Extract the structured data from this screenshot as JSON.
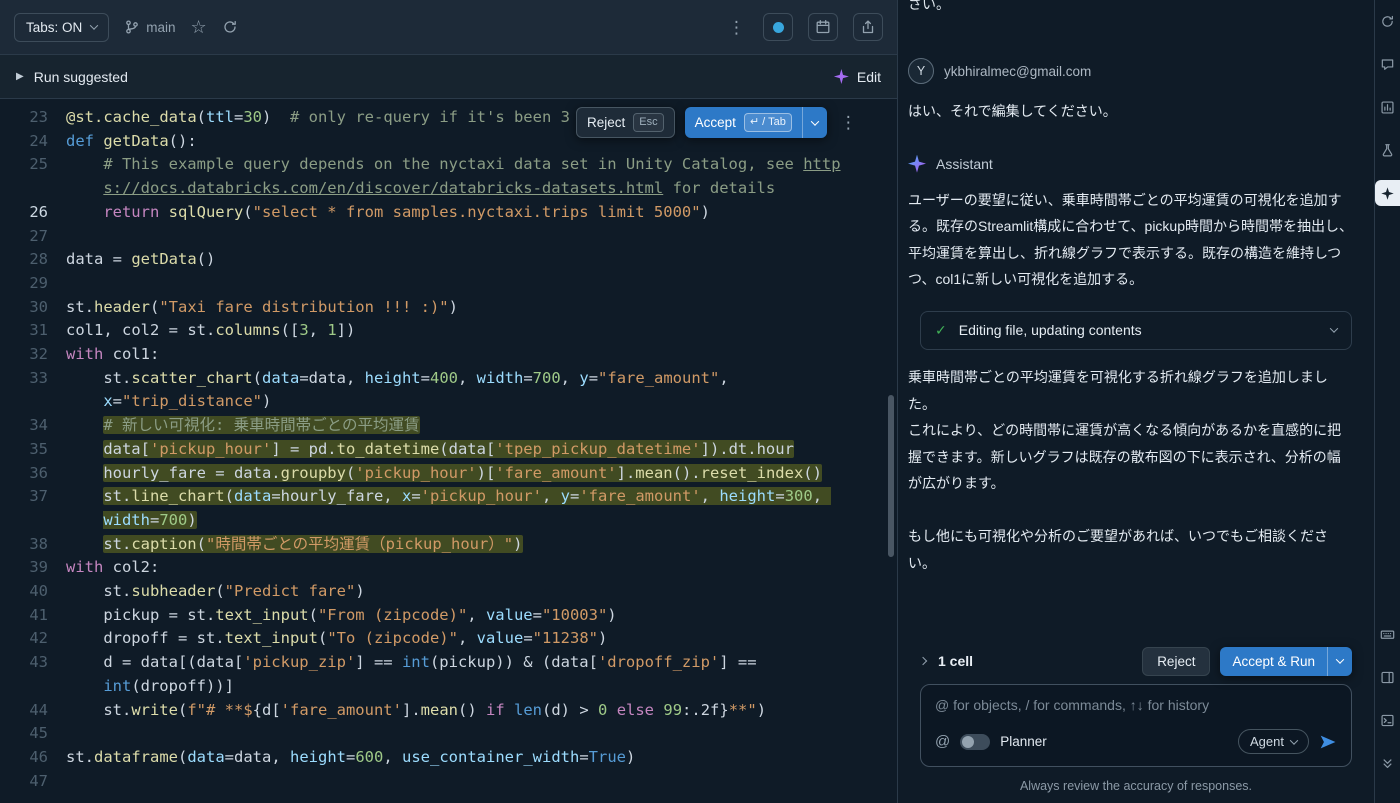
{
  "accent_color": "#2d79c7",
  "toolbar": {
    "tabs_button": "Tabs: ON",
    "branch_name": "main"
  },
  "run_bar": {
    "run_label": "Run suggested",
    "edit_label": "Edit"
  },
  "diff_popup": {
    "reject_label": "Reject",
    "reject_key": "Esc",
    "accept_label": "Accept",
    "accept_key": "↵ / Tab"
  },
  "editor": {
    "active_line": 26,
    "highlight_color": "#414b22",
    "lines": [
      {
        "n": 23,
        "i": 0,
        "h": false,
        "t": [
          [
            "d",
            "@st.cache_data"
          ],
          [
            "p",
            "("
          ],
          [
            "a",
            "ttl"
          ],
          [
            "p",
            "="
          ],
          [
            "n",
            "30"
          ],
          [
            "p",
            ")  "
          ],
          [
            "c",
            "# only re-query if it's been 3"
          ]
        ]
      },
      {
        "n": 24,
        "i": 0,
        "h": false,
        "t": [
          [
            "kb",
            "def "
          ],
          [
            "f",
            "getData"
          ],
          [
            "p",
            "():"
          ]
        ]
      },
      {
        "n": 25,
        "i": 4,
        "h": false,
        "t": [
          [
            "c",
            "# This example query depends on the nyctaxi data set in Unity Catalog, see "
          ],
          [
            "u",
            "https://docs.databricks.com/en/discover/databricks-datasets.html"
          ],
          [
            "c",
            " for details"
          ]
        ]
      },
      {
        "n": 26,
        "i": 4,
        "h": false,
        "t": [
          [
            "k",
            "return "
          ],
          [
            "f",
            "sqlQuery"
          ],
          [
            "p",
            "("
          ],
          [
            "s",
            "\"select * from samples.nyctaxi.trips limit 5000\""
          ],
          [
            "p",
            ")"
          ]
        ]
      },
      {
        "n": 27,
        "i": 0,
        "h": false,
        "t": []
      },
      {
        "n": 28,
        "i": 0,
        "h": false,
        "t": [
          [
            "p",
            "data = "
          ],
          [
            "f",
            "getData"
          ],
          [
            "p",
            "()"
          ]
        ]
      },
      {
        "n": 29,
        "i": 0,
        "h": false,
        "t": []
      },
      {
        "n": 30,
        "i": 0,
        "h": false,
        "t": [
          [
            "p",
            "st."
          ],
          [
            "f",
            "header"
          ],
          [
            "p",
            "("
          ],
          [
            "s",
            "\"Taxi fare distribution !!! :)\""
          ],
          [
            "p",
            ")"
          ]
        ]
      },
      {
        "n": 31,
        "i": 0,
        "h": false,
        "t": [
          [
            "p",
            "col1, col2 = st."
          ],
          [
            "f",
            "columns"
          ],
          [
            "p",
            "(["
          ],
          [
            "n",
            "3"
          ],
          [
            "p",
            ", "
          ],
          [
            "n",
            "1"
          ],
          [
            "p",
            "])"
          ]
        ]
      },
      {
        "n": 32,
        "i": 0,
        "h": false,
        "t": [
          [
            "k",
            "with"
          ],
          [
            "p",
            " col1:"
          ]
        ]
      },
      {
        "n": 33,
        "i": 4,
        "h": false,
        "t": [
          [
            "p",
            "st."
          ],
          [
            "f",
            "scatter_chart"
          ],
          [
            "p",
            "("
          ],
          [
            "a",
            "data"
          ],
          [
            "p",
            "=data, "
          ],
          [
            "a",
            "height"
          ],
          [
            "p",
            "="
          ],
          [
            "n",
            "400"
          ],
          [
            "p",
            ", "
          ],
          [
            "a",
            "width"
          ],
          [
            "p",
            "="
          ],
          [
            "n",
            "700"
          ],
          [
            "p",
            ", "
          ],
          [
            "a",
            "y"
          ],
          [
            "p",
            "="
          ],
          [
            "s",
            "\"fare_amount\""
          ],
          [
            "p",
            ", "
          ],
          [
            "a",
            "x"
          ],
          [
            "p",
            "="
          ],
          [
            "s",
            "\"trip_distance\""
          ],
          [
            "p",
            ")"
          ]
        ]
      },
      {
        "n": 34,
        "i": 4,
        "h": true,
        "t": [
          [
            "c",
            "# 新しい可視化: 乗車時間帯ごとの平均運賃"
          ]
        ]
      },
      {
        "n": 35,
        "i": 4,
        "h": true,
        "t": [
          [
            "p",
            "data["
          ],
          [
            "s",
            "'pickup_hour'"
          ],
          [
            "p",
            "] = pd."
          ],
          [
            "f",
            "to_datetime"
          ],
          [
            "p",
            "(data["
          ],
          [
            "s",
            "'tpep_pickup_datetime'"
          ],
          [
            "p",
            "]).dt.hour"
          ]
        ]
      },
      {
        "n": 36,
        "i": 4,
        "h": true,
        "t": [
          [
            "p",
            "hourly_fare = data."
          ],
          [
            "f",
            "groupby"
          ],
          [
            "p",
            "("
          ],
          [
            "s",
            "'pickup_hour'"
          ],
          [
            "p",
            ")["
          ],
          [
            "s",
            "'fare_amount'"
          ],
          [
            "p",
            "]."
          ],
          [
            "f",
            "mean"
          ],
          [
            "p",
            "()."
          ],
          [
            "f",
            "reset_index"
          ],
          [
            "p",
            "()"
          ]
        ]
      },
      {
        "n": 37,
        "i": 4,
        "h": true,
        "t": [
          [
            "p",
            "st."
          ],
          [
            "f",
            "line_chart"
          ],
          [
            "p",
            "("
          ],
          [
            "a",
            "data"
          ],
          [
            "p",
            "=hourly_fare, "
          ],
          [
            "a",
            "x"
          ],
          [
            "p",
            "="
          ],
          [
            "s",
            "'pickup_hour'"
          ],
          [
            "p",
            ", "
          ],
          [
            "a",
            "y"
          ],
          [
            "p",
            "="
          ],
          [
            "s",
            "'fare_amount'"
          ],
          [
            "p",
            ", "
          ],
          [
            "a",
            "height"
          ],
          [
            "p",
            "="
          ],
          [
            "n",
            "300"
          ],
          [
            "p",
            ", "
          ],
          [
            "a",
            "width"
          ],
          [
            "p",
            "="
          ],
          [
            "n",
            "700"
          ],
          [
            "p",
            ")"
          ]
        ]
      },
      {
        "n": 38,
        "i": 4,
        "h": true,
        "t": [
          [
            "p",
            "st."
          ],
          [
            "f",
            "caption"
          ],
          [
            "p",
            "("
          ],
          [
            "s",
            "\"時間帯ごとの平均運賃（pickup_hour）\""
          ],
          [
            "p",
            ")"
          ]
        ]
      },
      {
        "n": 39,
        "i": 0,
        "h": false,
        "t": [
          [
            "k",
            "with"
          ],
          [
            "p",
            " col2:"
          ]
        ]
      },
      {
        "n": 40,
        "i": 4,
        "h": false,
        "t": [
          [
            "p",
            "st."
          ],
          [
            "f",
            "subheader"
          ],
          [
            "p",
            "("
          ],
          [
            "s",
            "\"Predict fare\""
          ],
          [
            "p",
            ")"
          ]
        ]
      },
      {
        "n": 41,
        "i": 4,
        "h": false,
        "t": [
          [
            "p",
            "pickup = st."
          ],
          [
            "f",
            "text_input"
          ],
          [
            "p",
            "("
          ],
          [
            "s",
            "\"From (zipcode)\""
          ],
          [
            "p",
            ", "
          ],
          [
            "a",
            "value"
          ],
          [
            "p",
            "="
          ],
          [
            "s",
            "\"10003\""
          ],
          [
            "p",
            ")"
          ]
        ]
      },
      {
        "n": 42,
        "i": 4,
        "h": false,
        "t": [
          [
            "p",
            "dropoff = st."
          ],
          [
            "f",
            "text_input"
          ],
          [
            "p",
            "("
          ],
          [
            "s",
            "\"To (zipcode)\""
          ],
          [
            "p",
            ", "
          ],
          [
            "a",
            "value"
          ],
          [
            "p",
            "="
          ],
          [
            "s",
            "\"11238\""
          ],
          [
            "p",
            ")"
          ]
        ]
      },
      {
        "n": 43,
        "i": 4,
        "h": false,
        "t": [
          [
            "p",
            "d = data[(data["
          ],
          [
            "s",
            "'pickup_zip'"
          ],
          [
            "p",
            "] == "
          ],
          [
            "kb",
            "int"
          ],
          [
            "p",
            "(pickup)) & (data["
          ],
          [
            "s",
            "'dropoff_zip'"
          ],
          [
            "p",
            "] == "
          ],
          [
            "kb",
            "int"
          ],
          [
            "p",
            "(dropoff))]"
          ]
        ]
      },
      {
        "n": 44,
        "i": 4,
        "h": false,
        "t": [
          [
            "p",
            "st."
          ],
          [
            "f",
            "write"
          ],
          [
            "p",
            "("
          ],
          [
            "s",
            "f\"# **$"
          ],
          [
            "p",
            "{d["
          ],
          [
            "s",
            "'fare_amount'"
          ],
          [
            "p",
            "]."
          ],
          [
            "f",
            "mean"
          ],
          [
            "p",
            "() "
          ],
          [
            "k",
            "if"
          ],
          [
            "p",
            " "
          ],
          [
            "kb",
            "len"
          ],
          [
            "p",
            "(d) > "
          ],
          [
            "n",
            "0"
          ],
          [
            "p",
            " "
          ],
          [
            "k",
            "else"
          ],
          [
            "p",
            " "
          ],
          [
            "n",
            "99"
          ],
          [
            "p",
            ":.2f}"
          ],
          [
            "s",
            "**\""
          ],
          [
            "p",
            ")"
          ]
        ]
      },
      {
        "n": 45,
        "i": 0,
        "h": false,
        "t": []
      },
      {
        "n": 46,
        "i": 0,
        "h": false,
        "t": [
          [
            "p",
            "st."
          ],
          [
            "f",
            "dataframe"
          ],
          [
            "p",
            "("
          ],
          [
            "a",
            "data"
          ],
          [
            "p",
            "=data, "
          ],
          [
            "a",
            "height"
          ],
          [
            "p",
            "="
          ],
          [
            "n",
            "600"
          ],
          [
            "p",
            ", "
          ],
          [
            "a",
            "use_container_width"
          ],
          [
            "p",
            "="
          ],
          [
            "kb",
            "True"
          ],
          [
            "p",
            ")"
          ]
        ]
      },
      {
        "n": 47,
        "i": 0,
        "h": false,
        "t": []
      }
    ]
  },
  "chat": {
    "previous_tail": "さい。",
    "user": {
      "avatar_letter": "Y",
      "name": "ykbhiralmec@gmail.com",
      "message": "はい、それで編集してください。"
    },
    "assistant_label": "Assistant",
    "para1": "ユーザーの要望に従い、乗車時間帯ごとの平均運賃の可視化を追加する。既存のStreamlit構成に合わせて、pickup時間から時間帯を抽出し、平均運賃を算出し、折れ線グラフで表示する。既存の構造を維持しつつ、col1に新しい可視化を追加する。",
    "task_status": "Editing file, updating contents",
    "para2a": "乗車時間帯ごとの平均運賃を可視化する折れ線グラフを追加しました。",
    "para2b": "これにより、どの時間帯に運賃が高くなる傾向があるかを直感的に把握できます。新しいグラフは既存の散布図の下に表示され、分析の幅が広がります。",
    "para3": "もし他にも可視化や分析のご要望があれば、いつでもご相談ください。",
    "cells_label": "1 cell",
    "reject_label": "Reject",
    "accept_run_label": "Accept & Run",
    "input_placeholder": "@ for objects, / for commands, ↑↓ for history",
    "planner_label": "Planner",
    "agent_label": "Agent",
    "footer": "Always review the accuracy of responses."
  },
  "rail": {
    "items_top": [
      "sync",
      "comments",
      "experiments-chart",
      "flask",
      "assistant"
    ],
    "items_bottom": [
      "keyboard",
      "side-panel",
      "terminal",
      "collapse"
    ],
    "active": "assistant"
  }
}
